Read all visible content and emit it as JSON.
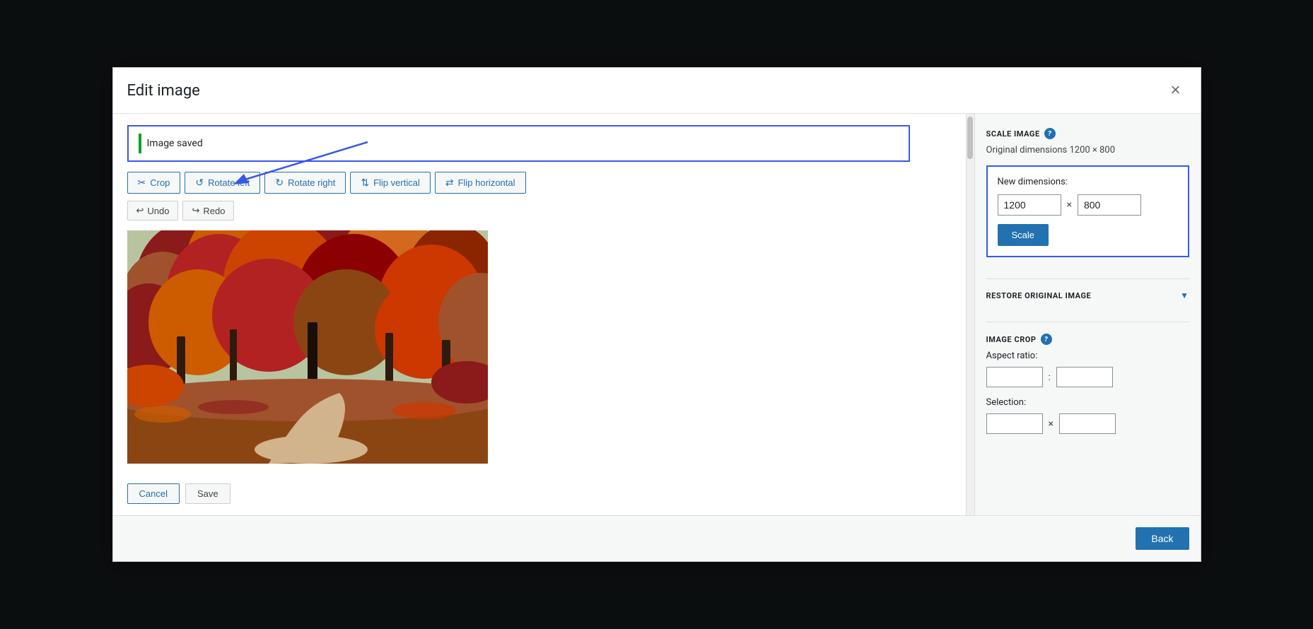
{
  "modal": {
    "title": "Edit image",
    "close_label": "×"
  },
  "notice": {
    "text": "Image saved"
  },
  "toolbar": {
    "crop_label": "Crop",
    "rotate_left_label": "Rotate left",
    "rotate_right_label": "Rotate right",
    "flip_vertical_label": "Flip vertical",
    "flip_horizontal_label": "Flip horizontal",
    "undo_label": "Undo",
    "redo_label": "Redo"
  },
  "footer_buttons": {
    "cancel_label": "Cancel",
    "save_label": "Save"
  },
  "right_panel": {
    "scale_image_title": "SCALE IMAGE",
    "original_dims_label": "Original dimensions 1200 × 800",
    "new_dimensions_label": "New dimensions:",
    "width_value": "1200",
    "height_value": "800",
    "scale_btn_label": "Scale",
    "restore_title": "RESTORE ORIGINAL IMAGE",
    "image_crop_title": "IMAGE CROP",
    "aspect_ratio_label": "Aspect ratio:",
    "selection_label": "Selection:",
    "help_icon": "?",
    "back_btn_label": "Back"
  }
}
